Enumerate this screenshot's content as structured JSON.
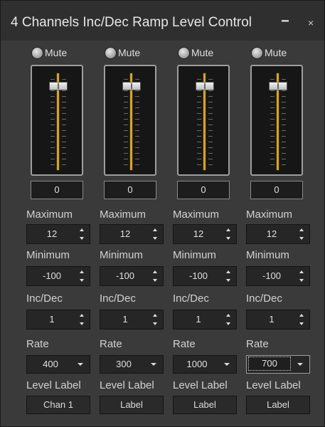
{
  "window": {
    "title": "4 Channels Inc/Dec Ramp Level Control",
    "minimize_glyph": "−",
    "close_glyph": "×"
  },
  "colors": {
    "background": "#3a3a3a",
    "fader_track": "#d4a52a"
  },
  "labels": {
    "mute": "Mute",
    "maximum": "Maximum",
    "minimum": "Minimum",
    "incdec": "Inc/Dec",
    "rate": "Rate",
    "level_label": "Level Label"
  },
  "channels": [
    {
      "level": 0,
      "level_text": "0",
      "maximum": "12",
      "minimum": "-100",
      "incdec": "1",
      "rate": "400",
      "label_button": "Chan 1"
    },
    {
      "level": 0,
      "level_text": "0",
      "maximum": "12",
      "minimum": "-100",
      "incdec": "1",
      "rate": "300",
      "label_button": "Label"
    },
    {
      "level": 0,
      "level_text": "0",
      "maximum": "12",
      "minimum": "-100",
      "incdec": "1",
      "rate": "1000",
      "label_button": "Label"
    },
    {
      "level": 0,
      "level_text": "0",
      "maximum": "12",
      "minimum": "-100",
      "incdec": "1",
      "rate": "700",
      "label_button": "Label",
      "rate_focused": true
    }
  ]
}
